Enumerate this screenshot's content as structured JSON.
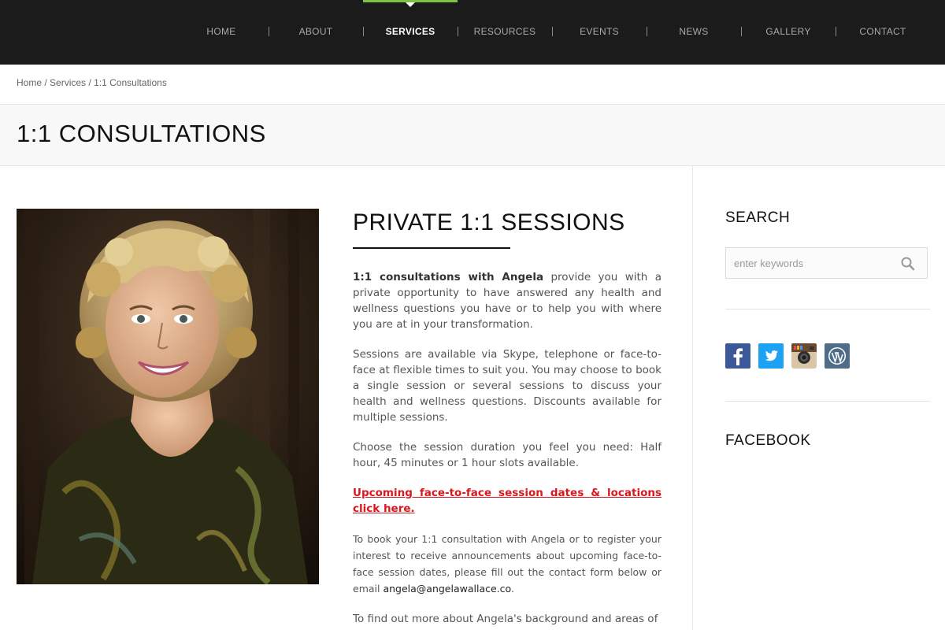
{
  "nav": {
    "items": [
      {
        "label": "HOME"
      },
      {
        "label": "ABOUT"
      },
      {
        "label": "SERVICES",
        "active": true
      },
      {
        "label": "RESOURCES"
      },
      {
        "label": "EVENTS"
      },
      {
        "label": "NEWS"
      },
      {
        "label": "GALLERY"
      },
      {
        "label": "CONTACT"
      }
    ]
  },
  "breadcrumb": {
    "home": "Home",
    "sep": "/",
    "services": "Services",
    "current": "1:1 Consultations"
  },
  "page": {
    "title": "1:1 CONSULTATIONS"
  },
  "content": {
    "heading": "PRIVATE 1:1 SESSIONS",
    "p1_bold": "1:1 consultations with Angela",
    "p1_rest": " provide you with a private opportunity to have answered any health and wellness questions you have or to help you with where you are at in your transformation.",
    "p2": "Sessions are available via Skype, telephone or face-to-face at flexible times to suit you. You may choose to book a  single session or several sessions to discuss your health and wellness questions. Discounts available for multiple sessions.",
    "p3": "Choose the session duration you feel you need: Half hour, 45 minutes or 1 hour slots available.",
    "link": "Upcoming face-to-face session dates & locations click here. ",
    "p4": "To book your 1:1 consultation with Angela or to register your interest to receive announcements about upcoming face-to-face session dates, please fill out the contact form below or email ",
    "email": "angela@angelawallace.co",
    "p4_end": ".",
    "p5": "To find out more about Angela's background and areas of"
  },
  "sidebar": {
    "search_heading": "SEARCH",
    "search_placeholder": "enter keywords",
    "facebook_heading": "FACEBOOK",
    "social_icons": [
      "facebook-icon",
      "twitter-icon",
      "instagram-icon",
      "wordpress-icon"
    ]
  },
  "colors": {
    "nav_bg": "#1b1b1b",
    "nav_active_bar": "#7dc242",
    "link_red": "#d9171c",
    "facebook": "#3b5998",
    "twitter": "#1da1f2",
    "wordpress": "#21759b"
  }
}
